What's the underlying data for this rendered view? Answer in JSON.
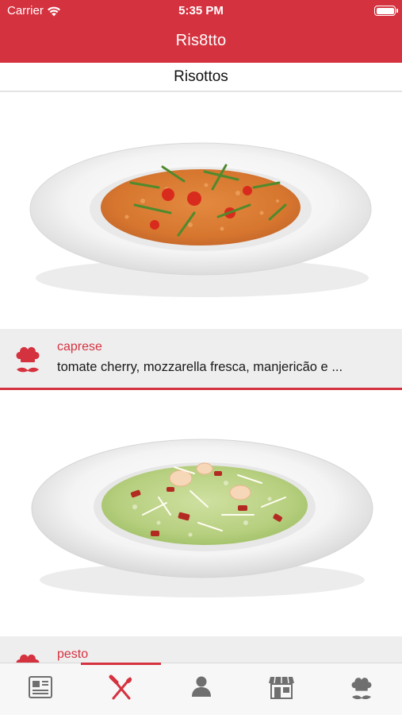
{
  "status_bar": {
    "carrier": "Carrier",
    "time": "5:35 PM"
  },
  "app": {
    "title": "Ris8tto"
  },
  "section": {
    "title": "Risottos"
  },
  "dishes": [
    {
      "name": "caprese",
      "description": "tomate cherry, mozzarella fresca, manjericão e ..."
    },
    {
      "name": "pesto",
      "description": ""
    }
  ],
  "tabs": [
    {
      "icon": "newspaper-icon",
      "active": false
    },
    {
      "icon": "fork-knife-icon",
      "active": true
    },
    {
      "icon": "user-icon",
      "active": false
    },
    {
      "icon": "store-icon",
      "active": false
    },
    {
      "icon": "chef-icon",
      "active": false
    }
  ],
  "colors": {
    "brand": "#d5323f",
    "info_bg": "#efeeef",
    "tab_inactive": "#6f6f6f"
  }
}
